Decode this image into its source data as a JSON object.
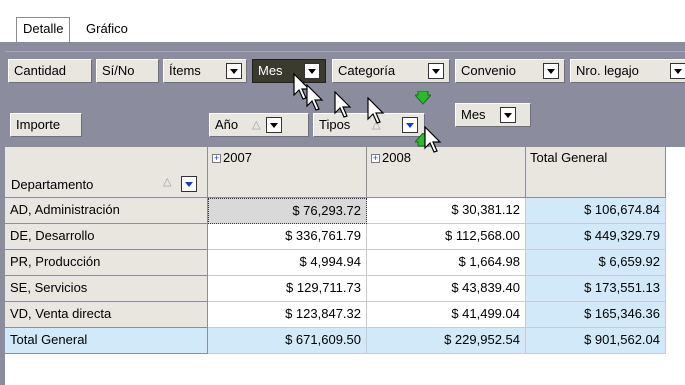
{
  "tabs": [
    {
      "label": "Detalle",
      "active": true
    },
    {
      "label": "Gráfico",
      "active": false
    }
  ],
  "filter_fields": [
    {
      "label": "Cantidad",
      "dropdown": false
    },
    {
      "label": "Sí/No",
      "dropdown": false
    },
    {
      "label": "Ítems",
      "dropdown": true
    },
    {
      "label": "Mes",
      "dropdown": true,
      "highlighted": true
    },
    {
      "label": "Categoría",
      "dropdown": true
    },
    {
      "label": "Convenio",
      "dropdown": true
    },
    {
      "label": "Nro. legajo",
      "dropdown": true
    }
  ],
  "data_field": {
    "label": "Importe"
  },
  "column_fields": [
    {
      "label": "Año",
      "sort_icon": "sort-asc-icon",
      "dropdown": true
    },
    {
      "label": "Tipos",
      "sort_icon": "sort-asc-icon",
      "dropdown": true,
      "blue": true
    },
    {
      "label": "Mes",
      "dropdown": true
    }
  ],
  "row_field": {
    "label": "Departamento",
    "sort_icon": "sort-asc-icon"
  },
  "columns": [
    {
      "label": "2007",
      "expandable": true
    },
    {
      "label": "2008",
      "expandable": true
    },
    {
      "label": "Total General",
      "expandable": false
    }
  ],
  "rows": [
    {
      "label": "AD, Administración",
      "values": [
        "$ 76,293.72",
        "$ 30,381.12",
        "$ 106,674.84"
      ]
    },
    {
      "label": "DE, Desarrollo",
      "values": [
        "$ 336,761.79",
        "$ 112,568.00",
        "$ 449,329.79"
      ]
    },
    {
      "label": "PR, Producción",
      "values": [
        "$ 4,994.94",
        "$ 1,664.98",
        "$ 6,659.92"
      ]
    },
    {
      "label": "SE, Servicios",
      "values": [
        "$ 129,711.73",
        "$ 43,839.40",
        "$ 173,551.13"
      ]
    },
    {
      "label": "VD, Venta directa",
      "values": [
        "$ 123,847.32",
        "$ 41,499.04",
        "$ 165,346.36"
      ]
    }
  ],
  "total_row": {
    "label": "Total General",
    "values": [
      "$ 671,609.50",
      "$ 229,952.54",
      "$ 901,562.04"
    ]
  },
  "colors": {
    "panel": "#8c8c9f",
    "button": "#e8e6df",
    "total_cell": "#d1e9f9",
    "selected_cell": "#d9d9d9",
    "drop_indicator": "#2eb82e"
  }
}
